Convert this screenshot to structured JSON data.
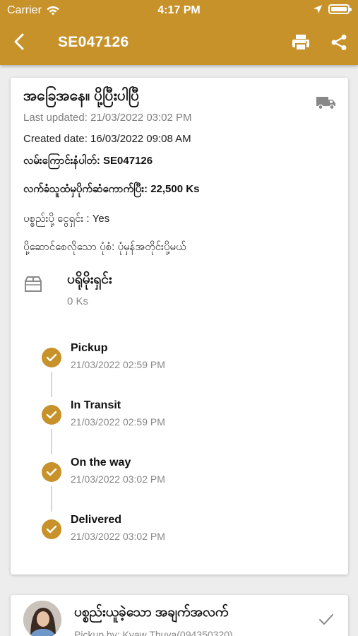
{
  "status_bar": {
    "carrier": "Carrier",
    "time": "4:17 PM"
  },
  "nav": {
    "title": "SE047126",
    "back_icon": "chevron-left-icon",
    "print_icon": "print-icon",
    "share_icon": "share-icon"
  },
  "detail": {
    "status_title": "အခြေအနေ။ ပို့ပြီးပါပြီ",
    "last_updated": "Last updated: 21/03/2022 03:02 PM",
    "created_date": "Created date: 16/03/2022 09:08 AM",
    "tracking_line": "လမ်းကြောင်းနံပါတ်: SE047126",
    "collected_line": "လက်ခံသူထံမှပိုက်ဆံကောက်ပြီး: 22,500 Ks",
    "sender_pays_line": "ပစ္စည်းပို့ ငွေရှင်း : Yes",
    "delivery_type_line": "ပို့ဆောင်စေလိုသော ပုံစံ: ပုံမှန်အတိုင်းပို့မယ်",
    "parcel_label": "ပရိုမိုးရှင်း",
    "parcel_value": "0 Ks"
  },
  "timeline": [
    {
      "label": "Pickup",
      "date": "21/03/2022 02:59 PM"
    },
    {
      "label": "In Transit",
      "date": "21/03/2022 02:59 PM"
    },
    {
      "label": "On the way",
      "date": "21/03/2022 03:02 PM"
    },
    {
      "label": "Delivered",
      "date": "21/03/2022 03:02 PM"
    }
  ],
  "pickup_card": {
    "title": "ပစ္စည်းယူခဲ့သော အချက်အလက်",
    "subtitle": "Pickup by: Kyaw Thuya(094350320)"
  },
  "colors": {
    "accent": "#c7922a",
    "background": "#ededed"
  }
}
